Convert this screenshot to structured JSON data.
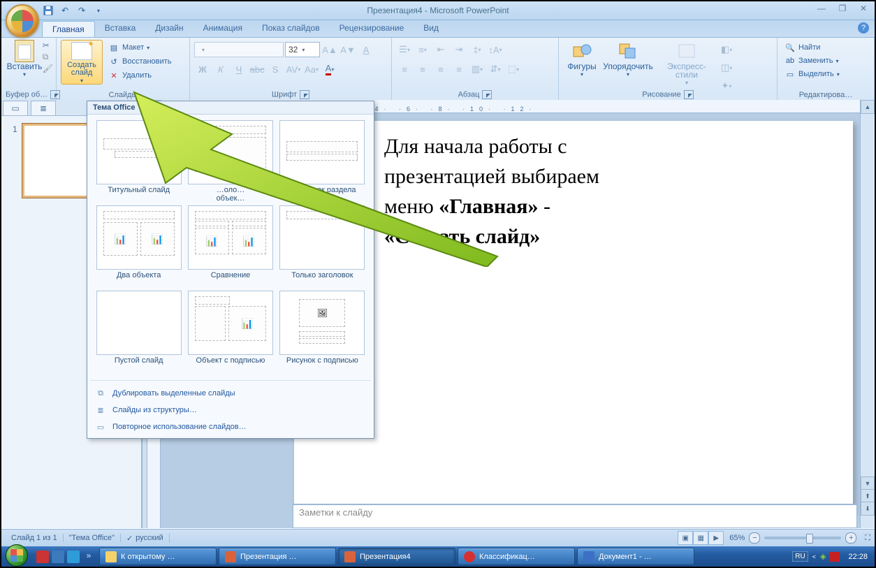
{
  "title": "Презентация4 - Microsoft PowerPoint",
  "tabs": {
    "home": "Главная",
    "insert": "Вставка",
    "design": "Дизайн",
    "animation": "Анимация",
    "slideshow": "Показ слайдов",
    "review": "Рецензирование",
    "view": "Вид"
  },
  "ribbon": {
    "clipboard": {
      "label": "Буфер об…",
      "paste": "Вставить"
    },
    "slides": {
      "label": "Слайды",
      "new": "Создать слайд",
      "layout": "Макет",
      "reset": "Восстановить",
      "delete": "Удалить"
    },
    "font": {
      "label": "Шрифт",
      "size": "32"
    },
    "paragraph": {
      "label": "Абзац"
    },
    "drawing": {
      "label": "Рисование",
      "shapes": "Фигуры",
      "arrange": "Упорядочить",
      "styles": "Экспресс-стили"
    },
    "editing": {
      "label": "Редактирова…",
      "find": "Найти",
      "replace": "Заменить",
      "select": "Выделить"
    }
  },
  "gallery": {
    "header": "Тема Office",
    "layouts": {
      "title": "Титульный слайд",
      "content_caption": "…оло…\nобъек…",
      "section": "Заголовок раздела",
      "two": "Два объекта",
      "compare": "Сравнение",
      "title_only": "Только заголовок",
      "blank": "Пустой слайд",
      "obj_caption": "Объект с подписью",
      "pic_caption": "Рисунок с подписью"
    },
    "menu": {
      "duplicate": "Дублировать выделенные слайды",
      "outline": "Слайды из структуры…",
      "reuse": "Повторное использование слайдов…"
    }
  },
  "slide1_number": "1",
  "instruction": {
    "line1": "Для начала работы с",
    "line2": "презентацией выбираем",
    "line3_a": "меню ",
    "line3_b": "«Главная»",
    "line3_c": " -",
    "line4": "«Создать слайд»"
  },
  "notes_placeholder": "Заметки к слайду",
  "ruler_text": "· ·8· ·6· ·4· ·2· ·0· ·2· ·4· ·6· ·8· ·10· ·12·",
  "status": {
    "slide": "Слайд 1 из 1",
    "theme": "\"Тема Office\"",
    "lang": "русский",
    "zoom": "65%"
  },
  "taskbar": {
    "items": {
      "a": "К открытому …",
      "b": "Презентация …",
      "c": "Презентация4",
      "d": "Классификац…",
      "e": "Документ1 - …"
    },
    "lang": "RU",
    "time": "22:28"
  }
}
